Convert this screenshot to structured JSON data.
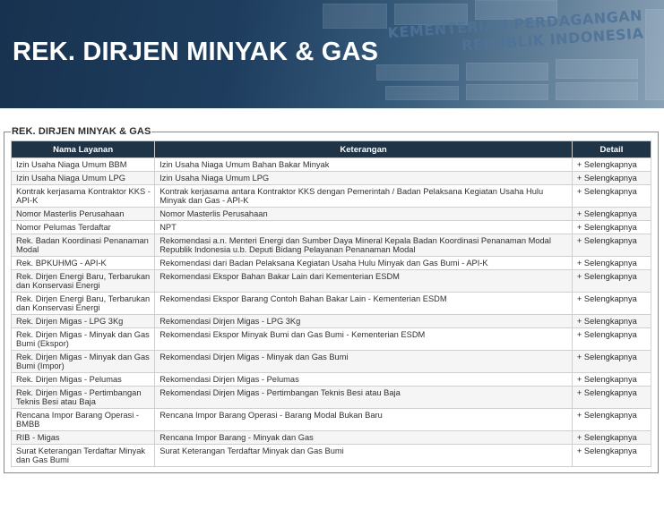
{
  "header": {
    "title": "REK. DIRJEN MINYAK & GAS",
    "building_sign_line1": "KEMENTERIAN PERDAGANGAN",
    "building_sign_line2": "REPUBLIK INDONESIA"
  },
  "panel": {
    "legend": "REK. DIRJEN MINYAK & GAS"
  },
  "table": {
    "columns": [
      "Nama Layanan",
      "Keterangan",
      "Detail"
    ],
    "rows": [
      {
        "name": "Izin Usaha Niaga Umum BBM",
        "desc": "Izin Usaha Niaga Umum Bahan Bakar Minyak",
        "link": "+ Selengkapnya"
      },
      {
        "name": "Izin Usaha Niaga Umum LPG",
        "desc": "Izin Usaha Niaga Umum LPG",
        "link": "+ Selengkapnya"
      },
      {
        "name": "Kontrak kerjasama Kontraktor KKS - API-K",
        "desc": "Kontrak kerjasama antara Kontraktor KKS dengan Pemerintah / Badan Pelaksana Kegiatan Usaha Hulu Minyak dan Gas - API-K",
        "link": "+ Selengkapnya"
      },
      {
        "name": "Nomor Masterlis Perusahaan",
        "desc": "Nomor Masterlis Perusahaan",
        "link": "+ Selengkapnya"
      },
      {
        "name": "Nomor Pelumas Terdaftar",
        "desc": "NPT",
        "link": "+ Selengkapnya"
      },
      {
        "name": "Rek. Badan Koordinasi Penanaman Modal",
        "desc": "Rekomendasi a.n. Menteri Energi dan Sumber Daya Mineral Kepala Badan Koordinasi Penanaman Modal Republik Indonesia u.b. Deputi Bidang Pelayanan Penanaman Modal",
        "link": "+ Selengkapnya"
      },
      {
        "name": "Rek. BPKUHMG - API-K",
        "desc": "Rekomendasi dari Badan Pelaksana Kegiatan Usaha Hulu Minyak dan Gas Bumi - API-K",
        "link": "+ Selengkapnya"
      },
      {
        "name": "Rek. Dirjen Energi Baru, Terbarukan dan Konservasi Energi",
        "desc": "Rekomendasi Ekspor Bahan Bakar Lain dari Kementerian ESDM",
        "link": "+ Selengkapnya"
      },
      {
        "name": "Rek. Dirjen Energi Baru, Terbarukan dan Konservasi Energi",
        "desc": "Rekomendasi Ekspor Barang Contoh Bahan Bakar Lain - Kementerian ESDM",
        "link": "+ Selengkapnya"
      },
      {
        "name": "Rek. Dirjen Migas - LPG 3Kg",
        "desc": "Rekomendasi Dirjen Migas - LPG 3Kg",
        "link": "+ Selengkapnya"
      },
      {
        "name": "Rek. Dirjen Migas - Minyak dan Gas Bumi (Ekspor)",
        "desc": "Rekomendasi Ekspor Minyak Bumi dan Gas Bumi - Kementerian ESDM",
        "link": "+ Selengkapnya"
      },
      {
        "name": "Rek. Dirjen Migas - Minyak dan Gas Bumi (Impor)",
        "desc": "Rekomendasi Dirjen Migas - Minyak dan Gas Bumi",
        "link": "+ Selengkapnya"
      },
      {
        "name": "Rek. Dirjen Migas - Pelumas",
        "desc": "Rekomendasi Dirjen Migas - Pelumas",
        "link": "+ Selengkapnya"
      },
      {
        "name": "Rek. Dirjen Migas - Pertimbangan Teknis Besi atau Baja",
        "desc": "Rekomendasi Dirjen Migas - Pertimbangan Teknis Besi atau Baja",
        "link": "+ Selengkapnya"
      },
      {
        "name": "Rencana Impor Barang Operasi - BMBB",
        "desc": "Rencana Impor Barang Operasi - Barang Modal Bukan Baru",
        "link": "+ Selengkapnya"
      },
      {
        "name": "RIB - Migas",
        "desc": "Rencana Impor Barang - Minyak dan Gas",
        "link": "+ Selengkapnya"
      },
      {
        "name": "Surat Keterangan Terdaftar Minyak dan Gas Bumi",
        "desc": "Surat Keterangan Terdaftar Minyak dan Gas Bumi",
        "link": "+ Selengkapnya"
      }
    ]
  }
}
